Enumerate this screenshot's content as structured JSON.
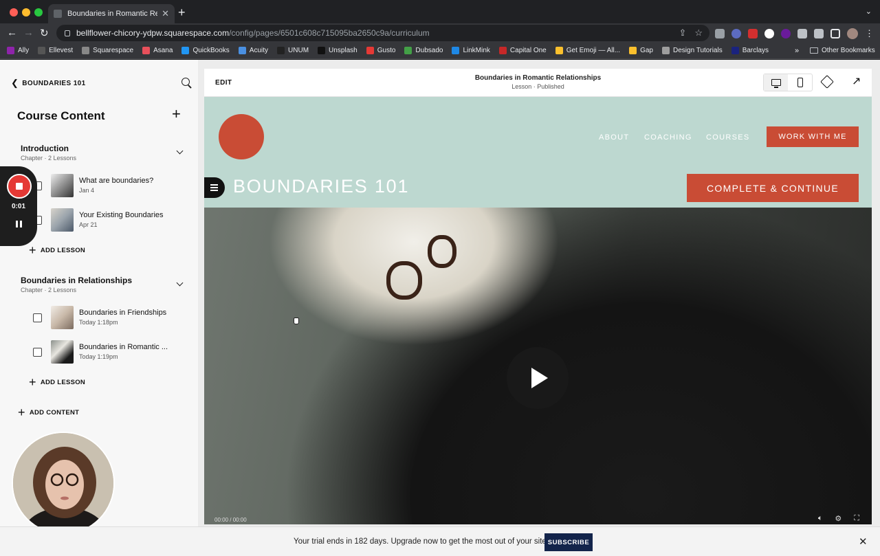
{
  "browser": {
    "tab_title": "Boundaries in Romantic Relatio",
    "tab_close": "✕",
    "new_tab": "+",
    "url_host": "bellflower-chicory-ydpw.squarespace.com",
    "url_path": "/config/pages/6501c608c715095ba2650c9a/curriculum",
    "bookmarks": [
      "Ally",
      "Ellevest",
      "Squarespace",
      "Asana",
      "QuickBooks",
      "Acuity",
      "UNUM",
      "Unsplash",
      "Gusto",
      "Dubsado",
      "LinkMink",
      "Capital One",
      "Get Emoji — All...",
      "Gap",
      "Design Tutorials",
      "Barclays"
    ],
    "bookmark_colors": [
      "#8e24aa",
      "#555555",
      "#888888",
      "#e8505b",
      "#2196f3",
      "#4a90e2",
      "#222222",
      "#111111",
      "#e53935",
      "#43a047",
      "#1e88e5",
      "#c62828",
      "#fbc02d",
      "#fbc02d",
      "#9e9e9e",
      "#1a237e"
    ],
    "more_bookmarks": "»",
    "other_bookmarks": "Other Bookmarks"
  },
  "sidebar": {
    "back_label": "BOUNDARIES 101",
    "title": "Course Content",
    "chapters": [
      {
        "name": "Introduction",
        "meta": "Chapter · 2 Lessons",
        "lessons": [
          {
            "title": "What are boundaries?",
            "date": "Jan 4"
          },
          {
            "title": "Your Existing Boundaries",
            "date": "Apr 21"
          }
        ]
      },
      {
        "name": "Boundaries in Relationships",
        "meta": "Chapter · 2 Lessons",
        "lessons": [
          {
            "title": "Boundaries in Friendships",
            "date": "Today 1:18pm"
          },
          {
            "title": "Boundaries in Romantic ...",
            "date": "Today 1:19pm"
          }
        ]
      }
    ],
    "add_lesson_label": "ADD LESSON",
    "add_content_label": "ADD CONTENT"
  },
  "recorder": {
    "time": "0:01",
    "accent": "#e53935"
  },
  "editor": {
    "edit_label": "EDIT",
    "page_title": "Boundaries in Romantic Relationships",
    "page_status": "Lesson · Published"
  },
  "site": {
    "nav": [
      "ABOUT",
      "COACHING",
      "COURSES"
    ],
    "cta": "WORK WITH ME",
    "title": "BOUNDARIES 101",
    "complete_label": "COMPLETE & CONTINUE",
    "header_bg": "#bdd8d0",
    "accent": "#c94c35"
  },
  "video": {
    "time": "00:00 / 00:00"
  },
  "trial": {
    "message": "Your trial ends in 182 days. Upgrade now to get the most out of your site.",
    "subscribe_label": "SUBSCRIBE"
  }
}
